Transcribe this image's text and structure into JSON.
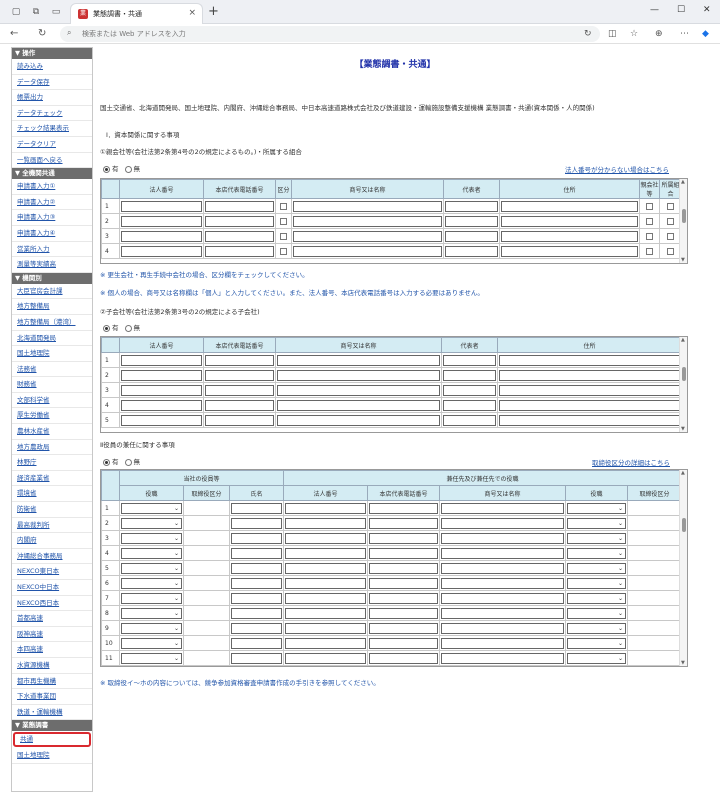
{
  "browser": {
    "tab_title": "業態調書・共通",
    "address_placeholder": "検索または Web アドレスを入力",
    "tab_close": "×",
    "new_tab": "+",
    "win_min": "—",
    "win_max": "☐",
    "win_close": "✕"
  },
  "sidebar": {
    "sections": [
      {
        "title": "▼ 操作",
        "items": [
          "読み込み",
          "データ保存",
          "帳票出力",
          "データチェック",
          "チェック結果表示",
          "データクリア",
          "一覧画面へ戻る"
        ]
      },
      {
        "title": "▼ 全機関共通",
        "items": [
          "申請書入力①",
          "申請書入力②",
          "申請書入力③",
          "申請書入力④",
          "営業所入力",
          "測量等実績高"
        ]
      },
      {
        "title": "▼ 機関別",
        "items": [
          "大臣官房会計課",
          "地方整備局",
          "地方整備局（港湾）",
          "北海道開発局",
          "国土地理院",
          "法務省",
          "財務省",
          "文部科学省",
          "厚生労働省",
          "農林水産省",
          "地方農政局",
          "林野庁",
          "経済産業省",
          "環境省",
          "防衛省",
          "最高裁判所",
          "内閣府",
          "沖縄総合事務局",
          "NEXCO東日本",
          "NEXCO中日本",
          "NEXCO西日本",
          "首都高速",
          "阪神高速",
          "本四高速",
          "水資源機構",
          "都市再生機構",
          "下水道事業団",
          "鉄道・運輸機構"
        ]
      },
      {
        "title": "▼ 業態調書",
        "items": [
          "共通",
          "国土地理院"
        ]
      }
    ],
    "selected": "共通"
  },
  "main": {
    "page_title": "【業態調書・共通】",
    "intro": "国土交通省、北海道開発局、国土地理院、内閣府、沖縄総合事務局、中日本高速道路株式会社及び鉄道建設・運輸施設整備支援機構 業態調書・共通(資本関係・人的関係)",
    "section1": "Ⅰ．資本関係に関する事項",
    "sub1": "①親会社等(会社法第2条第4号の2の規定によるもの。)・所属する組合",
    "radio_yes": "有",
    "radio_no": "無",
    "link1": "法人番号が分からない場合はこちら",
    "table1": {
      "headers": [
        "法人番号",
        "本店代表電話番号",
        "区分",
        "商号又は名称",
        "代表者",
        "住所",
        "親会社等",
        "所属組合"
      ],
      "rows": [
        "1",
        "2",
        "3",
        "4"
      ]
    },
    "note1": "※ 更生会社・再生手続中会社の場合、区分欄をチェックしてください。",
    "note2": "※ 個人の場合、商号又は名称欄は「個人」と入力してください。また、法人番号、本店代表電話番号は入力する必要はありません。",
    "sub2": "②子会社等(会社法第2条第3号の2の規定による子会社)",
    "table2": {
      "headers": [
        "法人番号",
        "本店代表電話番号",
        "商号又は名称",
        "代表者",
        "住所"
      ],
      "rows": [
        "1",
        "2",
        "3",
        "4",
        "5"
      ]
    },
    "section2": "Ⅱ役員の兼任に関する事項",
    "link2": "取締役区分の詳細はこちら",
    "table3": {
      "group1": "当社の役員等",
      "group2": "兼任先及び兼任先での役職",
      "headers": [
        "役職",
        "取締役区分",
        "氏名",
        "法人番号",
        "本店代表電話番号",
        "商号又は名称",
        "役職",
        "取締役区分"
      ],
      "rows": [
        "1",
        "2",
        "3",
        "4",
        "5",
        "6",
        "7",
        "8",
        "9",
        "10",
        "11"
      ]
    },
    "note3": "※ 取締役イ～ホの内容については、競争参加資格審査申請書作成の手引きを参照してください。"
  },
  "colors": {
    "header_bg": "#d4ecf3",
    "sidebar_head": "#6d6d6d",
    "link": "#2255aa",
    "title": "#2233aa",
    "highlight": "#d9292f"
  }
}
